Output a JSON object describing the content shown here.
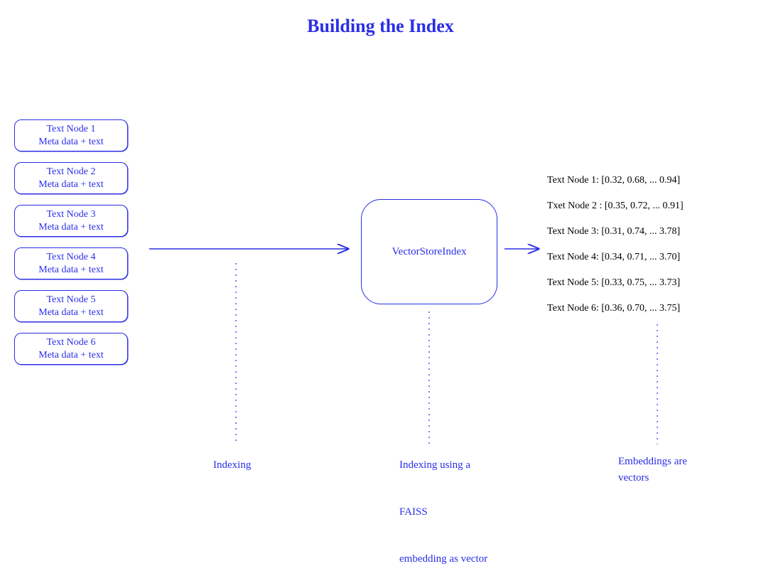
{
  "title": "Building the Index",
  "nodes": [
    {
      "line1": "Text Node 1",
      "line2": "Meta data + text"
    },
    {
      "line1": "Text Node 2",
      "line2": "Meta data + text"
    },
    {
      "line1": "Text Node 3",
      "line2": "Meta data + text"
    },
    {
      "line1": "Text Node 4",
      "line2": "Meta data + text"
    },
    {
      "line1": "Text Node 5",
      "line2": "Meta data + text"
    },
    {
      "line1": "Text Node 6",
      "line2": "Meta data + text"
    }
  ],
  "vsi_label": "VectorStoreIndex",
  "embeddings": [
    "Text Node 1: [0.32, 0.68, ... 0.94]",
    "Txet Node 2 : [0.35, 0.72, ... 0.91]",
    "Text Node 3: [0.31, 0.74, ... 3.78]",
    "Text Node 4: [0.34, 0.71, ... 3.70]",
    "Text Node 5: [0.33, 0.75, ... 3.73]",
    "Text Node 6: [0.36, 0.70, ... 3.75]"
  ],
  "captions": {
    "indexing": "Indexing",
    "faiss": "Indexing using a\n\nFAISS\n\nembedding as vector",
    "embeddings": "Embeddings are\nvectors"
  }
}
